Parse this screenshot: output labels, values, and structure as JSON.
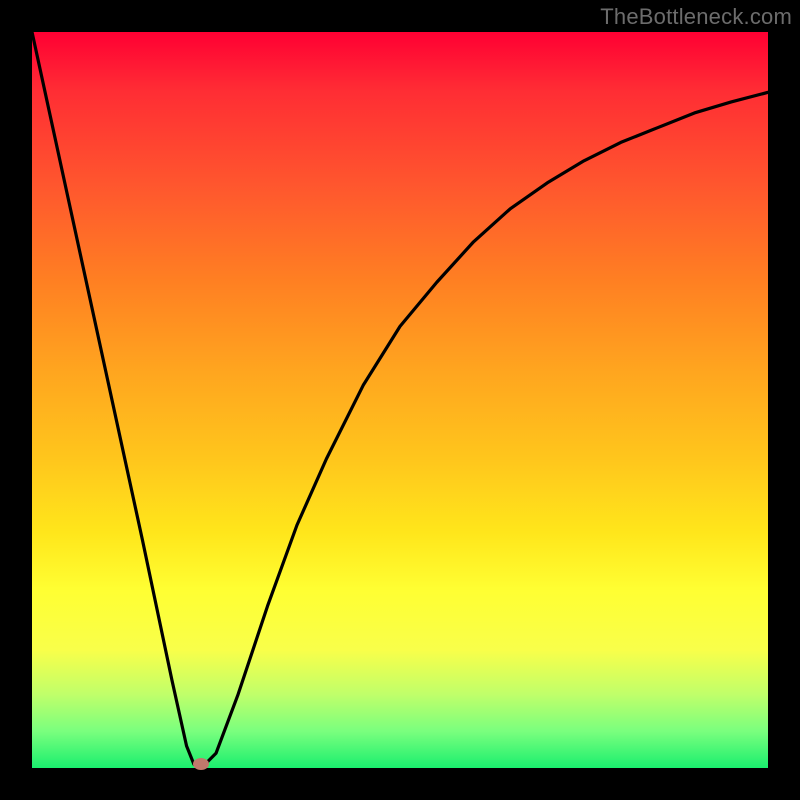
{
  "watermark": "TheBottleneck.com",
  "chart_data": {
    "type": "line",
    "title": "",
    "xlabel": "",
    "ylabel": "",
    "xlim": [
      0,
      100
    ],
    "ylim": [
      0,
      100
    ],
    "series": [
      {
        "name": "curve",
        "x": [
          0,
          5,
          10,
          15,
          19,
          21,
          22,
          23,
          25,
          28,
          32,
          36,
          40,
          45,
          50,
          55,
          60,
          65,
          70,
          75,
          80,
          85,
          90,
          95,
          100
        ],
        "values": [
          100,
          77,
          54,
          31,
          12,
          3,
          0.5,
          0,
          2,
          10,
          22,
          33,
          42,
          52,
          60,
          66,
          71.5,
          76,
          79.5,
          82.5,
          85,
          87,
          89,
          90.5,
          91.8
        ]
      }
    ],
    "marker": {
      "x": 23,
      "y": 0
    },
    "background_gradient": {
      "stops": [
        {
          "pos": 0,
          "color": "#ff0033"
        },
        {
          "pos": 50,
          "color": "#ffbb22"
        },
        {
          "pos": 80,
          "color": "#ffff33"
        },
        {
          "pos": 100,
          "color": "#1aef6e"
        }
      ]
    },
    "legend": false,
    "grid": false
  }
}
